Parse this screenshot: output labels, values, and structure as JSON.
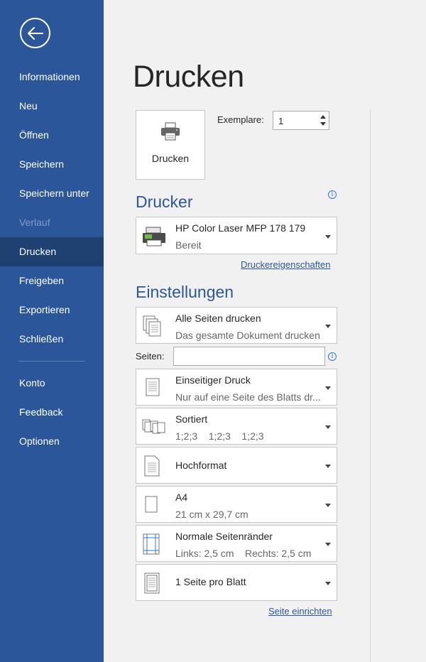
{
  "sidebar": {
    "items": [
      {
        "label": "Informationen"
      },
      {
        "label": "Neu"
      },
      {
        "label": "Öffnen"
      },
      {
        "label": "Speichern"
      },
      {
        "label": "Speichern unter"
      },
      {
        "label": "Verlauf",
        "state": "disabled"
      },
      {
        "label": "Drucken",
        "state": "active"
      },
      {
        "label": "Freigeben"
      },
      {
        "label": "Exportieren"
      },
      {
        "label": "Schließen"
      }
    ],
    "bottom_items": [
      {
        "label": "Konto"
      },
      {
        "label": "Feedback"
      },
      {
        "label": "Optionen"
      }
    ],
    "colors": {
      "background": "#2b579a",
      "active": "#1f4172"
    }
  },
  "main": {
    "title": "Drucken",
    "print_button_label": "Drucken",
    "copies": {
      "label": "Exemplare:",
      "value": "1"
    },
    "printer_section": {
      "title": "Drucker",
      "printer_name": "HP Color Laser MFP 178 179",
      "printer_status": "Bereit",
      "properties_link": "Druckereigenschaften"
    },
    "settings_section": {
      "title": "Einstellungen",
      "pages_label": "Seiten:",
      "pages_value": "",
      "options": [
        {
          "line1": "Alle Seiten drucken",
          "line2": "Das gesamte Dokument drucken",
          "icon": "pages-stack-icon"
        },
        {
          "line1": "Einseitiger Druck",
          "line2": "Nur auf eine Seite des Blatts dr...",
          "icon": "single-sided-icon"
        },
        {
          "line1": "Sortiert",
          "line2": "1;2;3    1;2;3    1;2;3",
          "icon": "collated-icon"
        },
        {
          "line1": "Hochformat",
          "line2": "",
          "icon": "portrait-icon"
        },
        {
          "line1": "A4",
          "line2": "21 cm x 29,7 cm",
          "icon": "paper-size-icon"
        },
        {
          "line1": "Normale Seitenränder",
          "line2": "Links: 2,5 cm    Rechts: 2,5 cm",
          "icon": "margins-icon"
        },
        {
          "line1": "1 Seite pro Blatt",
          "line2": "",
          "icon": "pages-per-sheet-icon"
        }
      ],
      "page_setup_link": "Seite einrichten"
    },
    "colors": {
      "accent": "#2b579a",
      "info": "#2b79d9"
    }
  }
}
